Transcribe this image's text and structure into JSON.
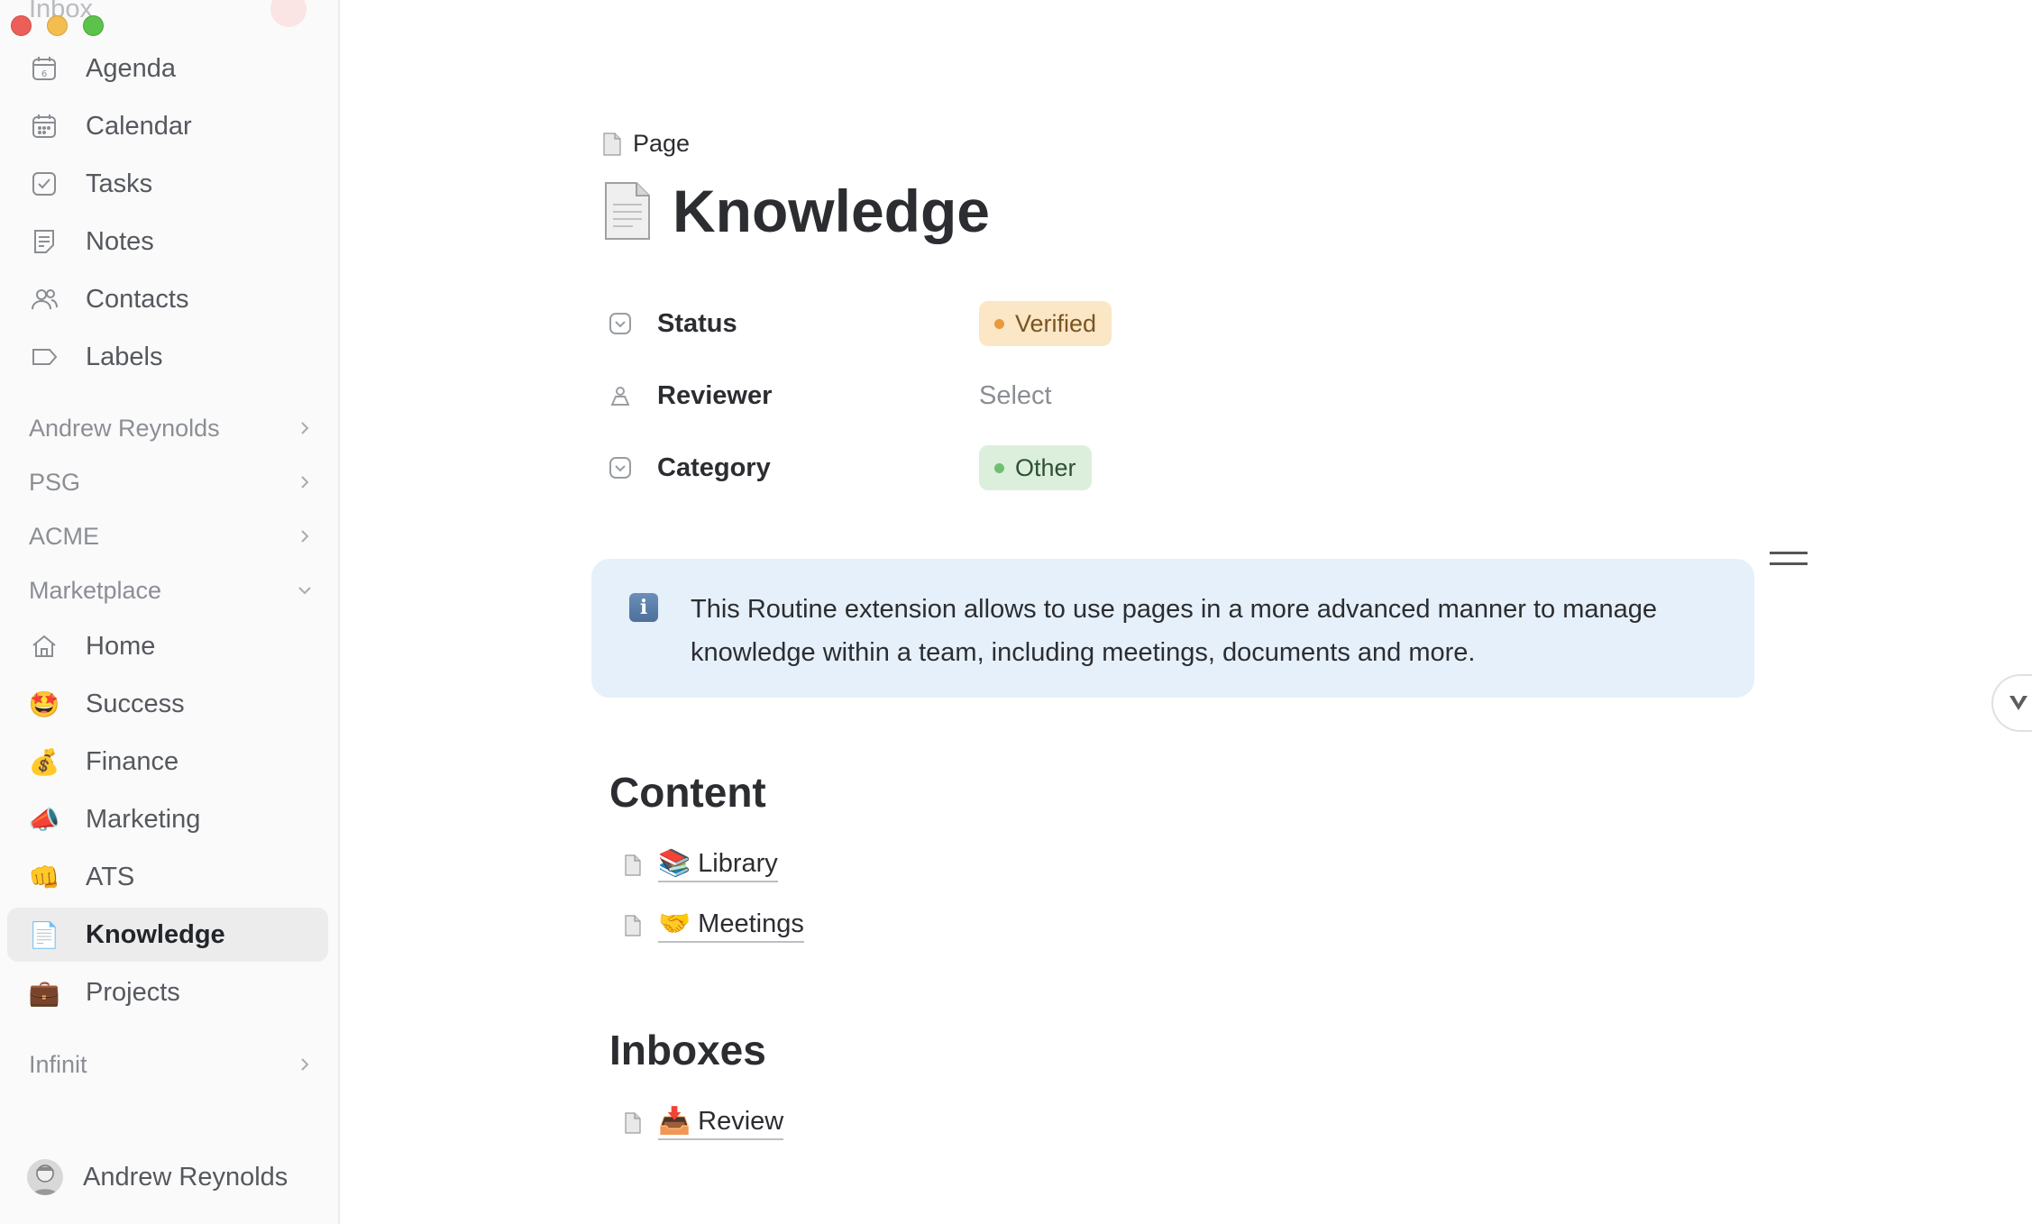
{
  "sidebar": {
    "ghost_top": "Inbox",
    "items_top": [
      {
        "label": "Agenda",
        "icon": "calendar-day-icon"
      },
      {
        "label": "Calendar",
        "icon": "calendar-grid-icon"
      },
      {
        "label": "Tasks",
        "icon": "checkbox-icon"
      },
      {
        "label": "Notes",
        "icon": "note-icon"
      },
      {
        "label": "Contacts",
        "icon": "people-icon"
      },
      {
        "label": "Labels",
        "icon": "tag-icon"
      }
    ],
    "groups": [
      {
        "label": "Andrew Reynolds"
      },
      {
        "label": "PSG"
      },
      {
        "label": "ACME"
      },
      {
        "label": "Marketplace"
      }
    ],
    "marketplace_items": [
      {
        "label": "Home",
        "icon": "home-icon",
        "emoji": ""
      },
      {
        "label": "Success",
        "icon": "star-struck-emoji-icon",
        "emoji": "🤩"
      },
      {
        "label": "Finance",
        "icon": "money-bag-emoji-icon",
        "emoji": "💰"
      },
      {
        "label": "Marketing",
        "icon": "megaphone-emoji-icon",
        "emoji": "📣"
      },
      {
        "label": "ATS",
        "icon": "fist-emoji-icon",
        "emoji": "👊"
      },
      {
        "label": "Knowledge",
        "icon": "page-emoji-icon",
        "emoji": "📄"
      },
      {
        "label": "Projects",
        "icon": "briefcase-emoji-icon",
        "emoji": "💼"
      }
    ],
    "infinit_group": "Infinit",
    "user_name": "Andrew Reynolds"
  },
  "page": {
    "breadcrumb": "Page",
    "title": "Knowledge",
    "properties": {
      "status_label": "Status",
      "status_value": "Verified",
      "reviewer_label": "Reviewer",
      "reviewer_value": "Select",
      "category_label": "Category",
      "category_value": "Other"
    },
    "callout": "This Routine extension allows to use pages in a more advanced manner to manage knowledge within a team, including meetings, documents and more.",
    "content_heading": "Content",
    "content_links": [
      "📚 Library",
      "🤝 Meetings"
    ],
    "inboxes_heading": "Inboxes",
    "inbox_links": [
      "📥 Review"
    ]
  },
  "colors": {
    "status_verified_bg": "#fbe6c6",
    "category_other_bg": "#dcefdc",
    "callout_bg": "#e6f0fa",
    "active_item_bg": "#ececed"
  }
}
